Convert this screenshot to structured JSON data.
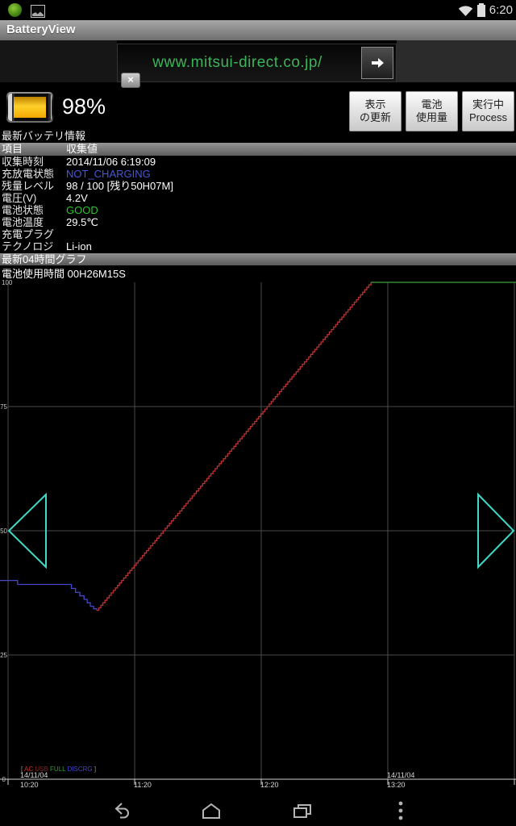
{
  "status_bar": {
    "time": "6:20"
  },
  "title_bar": {
    "title": "BatteryView"
  },
  "ad_banner": {
    "url_text": "www.mitsui-direct.co.jp/",
    "close_label": "×",
    "link_color": "#3db45a"
  },
  "battery_summary": {
    "percent": "98%",
    "section_title": "最新バッテリ情報",
    "buttons": [
      {
        "name": "refresh-display-button",
        "label": "表示\nの更新"
      },
      {
        "name": "battery-usage-button",
        "label": "電池\n使用量"
      },
      {
        "name": "running-process-button",
        "label": "実行中\nProcess"
      }
    ]
  },
  "info_table": {
    "headers": [
      "項目",
      "収集値"
    ],
    "rows": [
      {
        "label": "収集時刻",
        "value": "2014/11/06 6:19:09",
        "color": "#ffffff"
      },
      {
        "label": "充放電状態",
        "value": "NOT_CHARGING",
        "color": "#4758d6"
      },
      {
        "label": "残量レベル",
        "value": "98 / 100 [残り50H07M]",
        "color": "#ffffff"
      },
      {
        "label": "電圧(V)",
        "value": "4.2V",
        "color": "#ffffff"
      },
      {
        "label": "電池状態",
        "value": "GOOD",
        "color": "#2ec22e"
      },
      {
        "label": "電池温度",
        "value": "29.5℃",
        "color": "#ffffff"
      },
      {
        "label": "充電プラグ",
        "value": "",
        "color": "#ffffff"
      },
      {
        "label": "テクノロジ",
        "value": "Li-ion",
        "color": "#ffffff"
      }
    ]
  },
  "graph_section": {
    "title": "最新04時間グラフ",
    "usage_time": "電池使用時間 00H26M15S",
    "prev_arrow_points": "11,313 57,268 57,358",
    "next_arrow_points": "637,313 593,268 593,358"
  },
  "chart_data": {
    "type": "line",
    "title": "最新04時間グラフ",
    "subtitle": "電池使用時間 00H26M15S",
    "ylim": [
      0,
      100
    ],
    "yticks": [
      0,
      25,
      50,
      75,
      100
    ],
    "x_range_minutes": 240,
    "grid": {
      "vlines_minutes": [
        0,
        60,
        120,
        180,
        240
      ],
      "hlines_values": [
        25,
        50,
        75
      ]
    },
    "xticks": [
      {
        "min": 0,
        "date": "14/11/04",
        "time": "10:20"
      },
      {
        "min": 60,
        "time": "11:20"
      },
      {
        "min": 120,
        "time": "12:20"
      },
      {
        "min": 180,
        "date": "14/11/04",
        "time": "13:20"
      },
      {
        "min": 240
      }
    ],
    "legend": {
      "open_bracket": "[",
      "close_bracket": "]",
      "items": [
        {
          "label": "AC",
          "color": "#d02a2a"
        },
        {
          "label": "USB",
          "color": "#8a2020"
        },
        {
          "label": "FULL",
          "color": "#2aa42a"
        },
        {
          "label": "DISCRG",
          "color": "#4545cf"
        }
      ]
    },
    "series": [
      {
        "name": "DISCRG",
        "color": "#4646c8",
        "style": "step",
        "points": [
          [
            -4,
            40
          ],
          [
            3,
            40
          ],
          [
            4.5,
            39.2
          ],
          [
            28,
            39.2
          ],
          [
            30,
            38.4
          ],
          [
            32,
            37.6
          ],
          [
            34,
            36.9
          ],
          [
            36,
            36.2
          ],
          [
            37.5,
            35.5
          ],
          [
            39,
            34.8
          ],
          [
            40.5,
            34.3
          ],
          [
            42,
            34
          ]
        ]
      },
      {
        "name": "AC",
        "color": "#b93232",
        "style": "ramp-steps",
        "step_value": 0.5,
        "points": [
          [
            42,
            34
          ],
          [
            172,
            100
          ]
        ]
      },
      {
        "name": "FULL",
        "color": "#3da43d",
        "style": "line",
        "points": [
          [
            172,
            100
          ],
          [
            241,
            100
          ]
        ]
      }
    ],
    "colors": {
      "grid": "#4a4a4a",
      "axis": "#cfcfcf",
      "tick_text": "#c8c8c8",
      "bracket": "#909090",
      "arrow": "#3fd8c6"
    }
  },
  "nav_bar": {
    "icons": [
      "back-icon",
      "home-icon",
      "recents-icon",
      "overflow-menu-icon"
    ]
  }
}
